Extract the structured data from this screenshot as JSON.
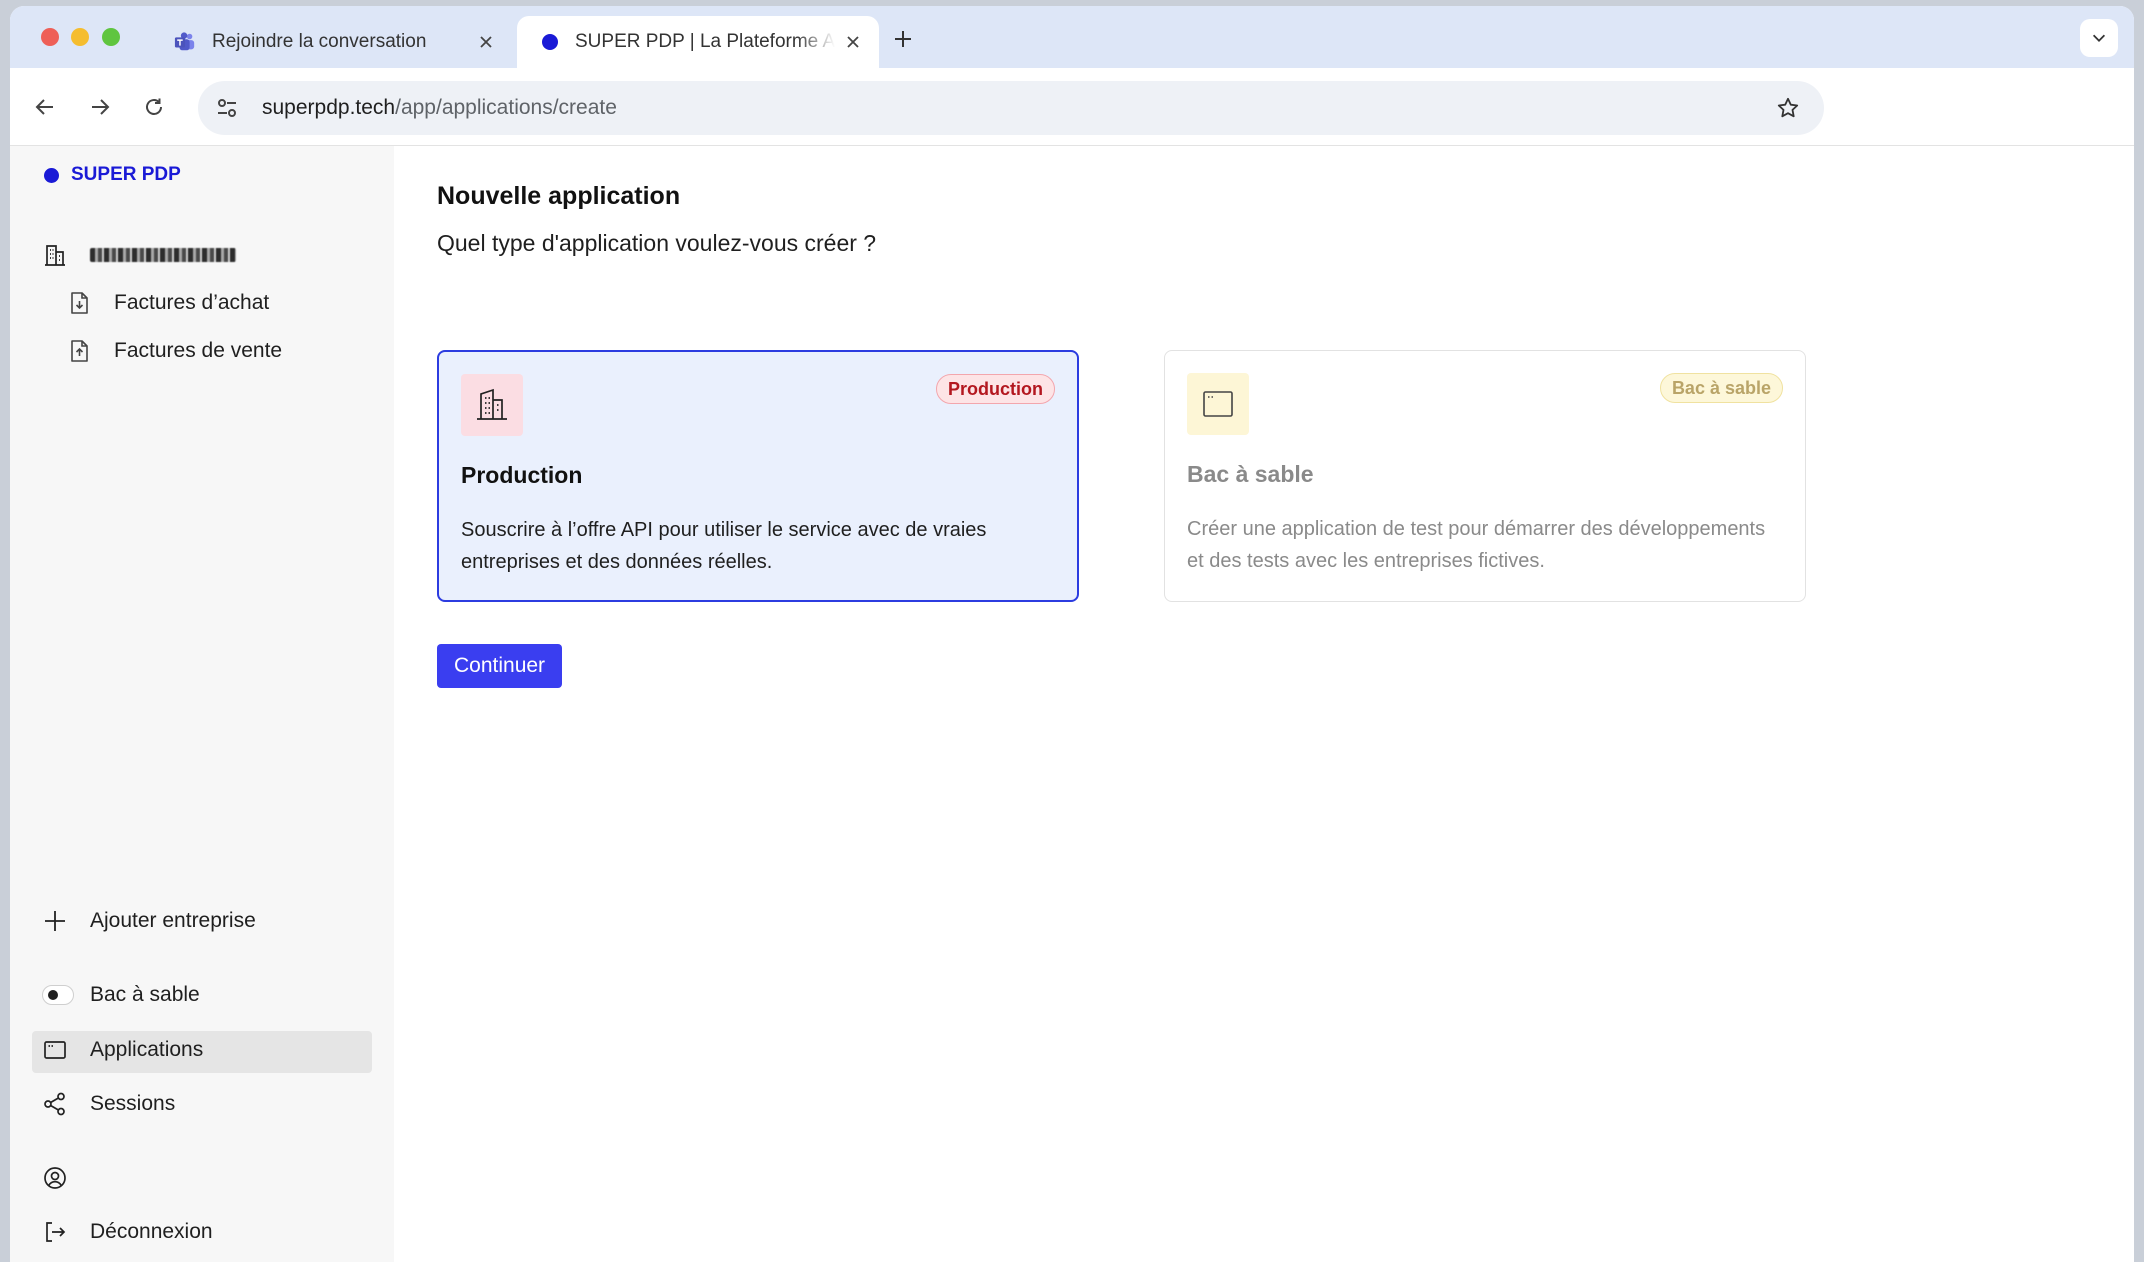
{
  "browser": {
    "tabs": [
      {
        "title": "Rejoindre la conversation",
        "icon": "teams-icon",
        "active": false
      },
      {
        "title": "SUPER PDP | La Plateforme Agréée",
        "icon": "superpdp-dot-icon",
        "active": true
      }
    ],
    "url_host": "superpdp.tech",
    "url_path": "/app/applications/create"
  },
  "sidebar": {
    "brand": "SUPER PDP",
    "company_name": "",
    "company_items": [
      {
        "label": "Factures d’achat",
        "icon": "invoice-download-icon"
      },
      {
        "label": "Factures de vente",
        "icon": "invoice-upload-icon"
      }
    ],
    "add_company": "Ajouter entreprise",
    "sandbox_toggle": "Bac à sable",
    "nav": [
      {
        "label": "Applications",
        "icon": "app-window-icon",
        "active": true
      },
      {
        "label": "Sessions",
        "icon": "share-icon",
        "active": false
      }
    ],
    "account_icon": "user-circle-icon",
    "logout": "Déconnexion"
  },
  "main": {
    "title": "Nouvelle application",
    "subtitle": "Quel type d'application voulez-vous créer ?",
    "cards": [
      {
        "badge": "Production",
        "title": "Production",
        "description": "Souscrire à l’offre API pour utiliser le service avec de vraies entreprises et des données réelles.",
        "selected": true,
        "icon": "building-icon"
      },
      {
        "badge": "Bac à sable",
        "title": "Bac à sable",
        "description": "Créer une application de test pour démarrer des développements et des tests avec les entreprises fictives.",
        "selected": false,
        "icon": "window-icon"
      }
    ],
    "continue_label": "Continuer"
  },
  "colors": {
    "brand": "#1a1ad6",
    "primary_button": "#3a3ef0",
    "selected_border": "#2c3ce0",
    "selected_bg": "#eaf0fd",
    "badge_production": "#b3171f",
    "badge_sandbox": "#b9a468"
  }
}
